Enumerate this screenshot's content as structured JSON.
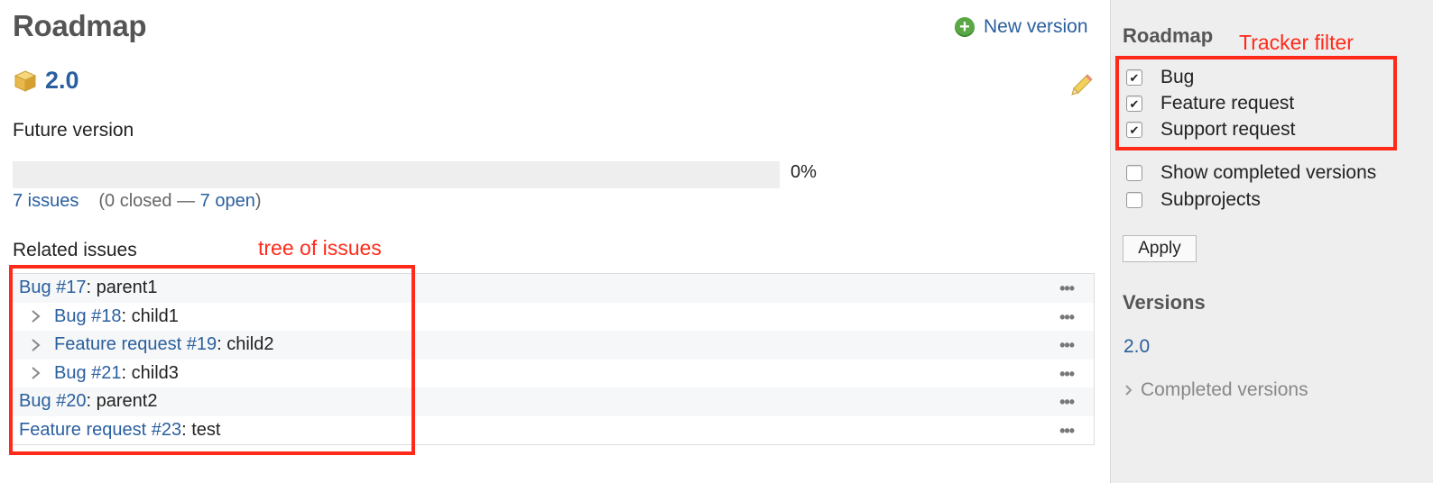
{
  "main": {
    "title": "Roadmap",
    "new_version_label": "New version",
    "version": {
      "name": "2.0",
      "description": "Future version",
      "progress": 0,
      "progress_label": "0%",
      "issues_link": "7 issues",
      "counts_prefix": "(0 closed —",
      "open_link": "7 open",
      "counts_suffix": ")"
    },
    "related_title": "Related issues",
    "issues": [
      {
        "link": "Bug #17",
        "subject": ": parent1",
        "child": false
      },
      {
        "link": "Bug #18",
        "subject": ": child1",
        "child": true
      },
      {
        "link": "Feature request #19",
        "subject": ": child2",
        "child": true
      },
      {
        "link": "Bug #21",
        "subject": ": child3",
        "child": true
      },
      {
        "link": "Bug #20",
        "subject": ": parent2",
        "child": false
      },
      {
        "link": "Feature request #23",
        "subject": ": test",
        "child": false
      }
    ],
    "row_menu_label": "•••"
  },
  "sidebar": {
    "roadmap_title": "Roadmap",
    "trackers": [
      {
        "label": "Bug",
        "checked": true
      },
      {
        "label": "Feature request",
        "checked": true
      },
      {
        "label": "Support request",
        "checked": true
      }
    ],
    "options": [
      {
        "label": "Show completed versions",
        "checked": false
      },
      {
        "label": "Subprojects",
        "checked": false
      }
    ],
    "apply_label": "Apply",
    "versions_title": "Versions",
    "versions": [
      "2.0"
    ],
    "completed_versions_label": "Completed versions"
  },
  "annotations": {
    "tree_label": "tree of issues",
    "tracker_label": "Tracker filter",
    "color": "#ff2a1a"
  },
  "icons": {
    "new_version": "plus-circle-icon",
    "version": "package-icon",
    "edit": "pencil-icon",
    "expand": "chevron-right-icon",
    "row_menu": "ellipsis-icon",
    "checkbox": "checkmark-icon"
  }
}
